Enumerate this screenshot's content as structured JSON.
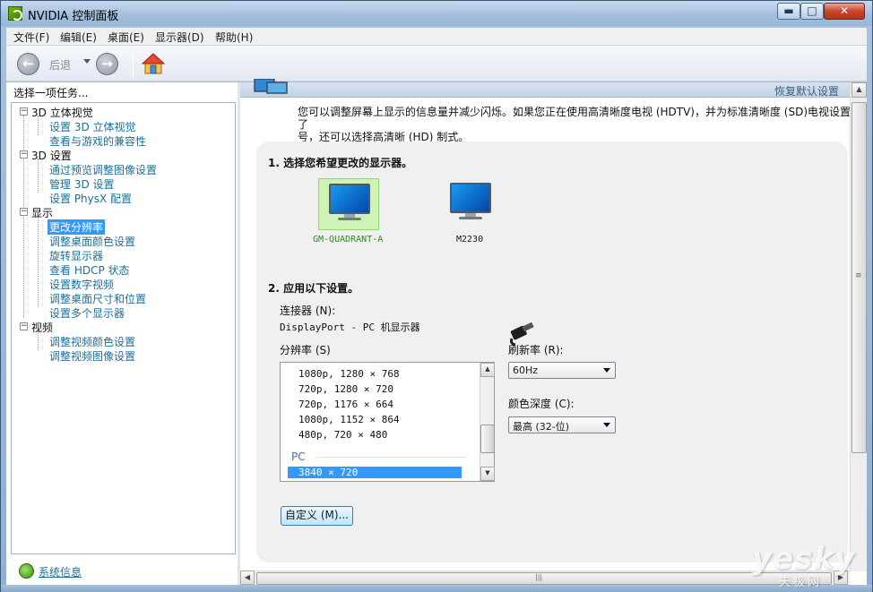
{
  "window": {
    "title": "NVIDIA 控制面板",
    "minimize": "▬",
    "maximize": "□",
    "close": "✕"
  },
  "menu": [
    "文件(F)",
    "编辑(E)",
    "桌面(E)",
    "显示器(D)",
    "帮助(H)"
  ],
  "toolbar": {
    "back_label": "后退",
    "back_glyph": "←",
    "forward_glyph": "→"
  },
  "left": {
    "header": "选择一项任务...",
    "categories": [
      {
        "label": "3D 立体视觉",
        "expander": "−",
        "items": [
          "设置 3D 立体视觉",
          "查看与游戏的兼容性"
        ]
      },
      {
        "label": "3D 设置",
        "expander": "−",
        "items": [
          "通过预览调整图像设置",
          "管理 3D 设置",
          "设置 PhysX 配置"
        ]
      },
      {
        "label": "显示",
        "expander": "−",
        "items": [
          "更改分辨率",
          "调整桌面颜色设置",
          "旋转显示器",
          "查看 HDCP 状态",
          "设置数字视频",
          "调整桌面尺寸和位置",
          "设置多个显示器"
        ]
      },
      {
        "label": "视频",
        "expander": "−",
        "items": [
          "调整视频颜色设置",
          "调整视频图像设置"
        ]
      }
    ],
    "selected_item": "更改分辨率",
    "system_info": "系统信息"
  },
  "right": {
    "restore_defaults": "恢复默认设置",
    "description_line1": "您可以调整屏幕上显示的信息量并减少闪烁。如果您正在使用高清晰度电视 (HDTV)，并为标准清晰度 (SD)电视设置了",
    "description_line2": "号，还可以选择高清晰 (HD) 制式。",
    "step1": "1. 选择您希望更改的显示器。",
    "displays": [
      {
        "name": "GM-QUADRANT-A",
        "selected": true
      },
      {
        "name": "M2230",
        "selected": false
      }
    ],
    "step2": "2. 应用以下设置。",
    "connector_label": "连接器 (N):",
    "connector_value": "DisplayPort - PC 机显示器",
    "resolution_label": "分辨率 (S)",
    "resolutions": [
      "1080p, 1280 × 768",
      "720p, 1280 × 720",
      "720p, 1176 × 664",
      "1080p, 1152 × 864",
      "480p, 720 × 480"
    ],
    "resolution_group": "PC",
    "resolution_selected": "3840 × 720",
    "refresh_label": "刷新率 (R):",
    "refresh_value": "60Hz",
    "color_depth_label": "颜色深度 (C):",
    "color_depth_value": "最高 (32-位)",
    "custom_button": "自定义 (M)...",
    "scroll_up": "▲",
    "scroll_down": "▼",
    "grip": "≡",
    "hgrip": "|||",
    "hleft": "◀",
    "hright": "▶"
  },
  "watermark": {
    "text": "yesky",
    "sub": "天极网"
  }
}
